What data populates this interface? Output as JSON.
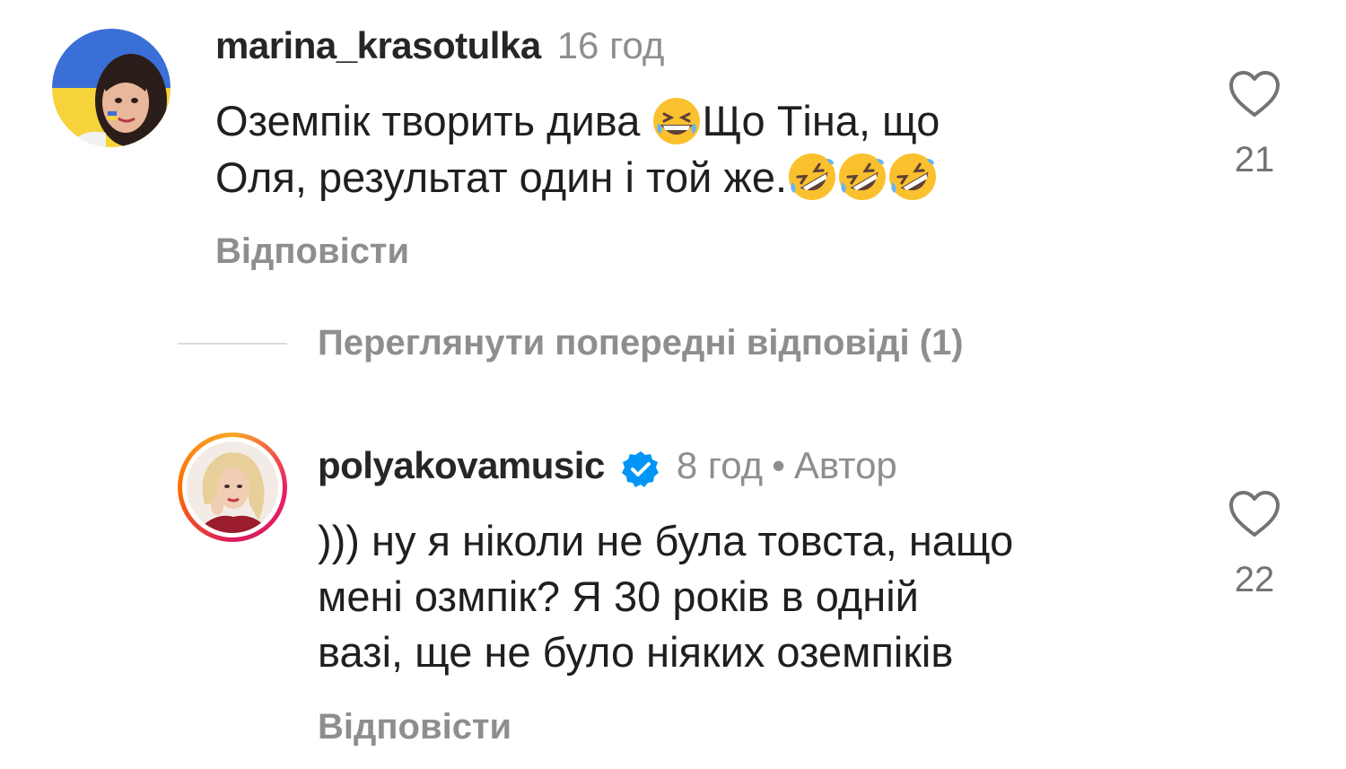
{
  "comments": [
    {
      "username": "marina_krasotulka",
      "time": "16 год",
      "text_line1": "Оземпік  творить дива ",
      "text_line1b": "Що Тіна, що",
      "text_line2": "Оля, результат один і той же.",
      "reply_label": "Відповісти",
      "likes": "21"
    },
    {
      "username": "polyakovamusic",
      "time": "8 год",
      "separator": "•",
      "author_label": "Автор",
      "text_line1": "))) ну я ніколи не була товста, нащо",
      "text_line2": "мені озмпік? Я 30 років в одній",
      "text_line3": "вазі, ще не було ніяких оземпіків",
      "reply_label": "Відповісти",
      "likes": "22"
    }
  ],
  "view_replies_label": "Переглянути попередні відповіді (1)",
  "icons": {
    "like": "heart-outline-icon",
    "verified": "verified-badge-icon",
    "emoji_laugh": "grinning-squinting-face-emoji",
    "emoji_rofl": "rolling-on-floor-laughing-emoji"
  },
  "colors": {
    "verified_blue": "#0095f6",
    "muted_text": "#8e8e8e",
    "emoji_yellow": "#fbc02d"
  }
}
